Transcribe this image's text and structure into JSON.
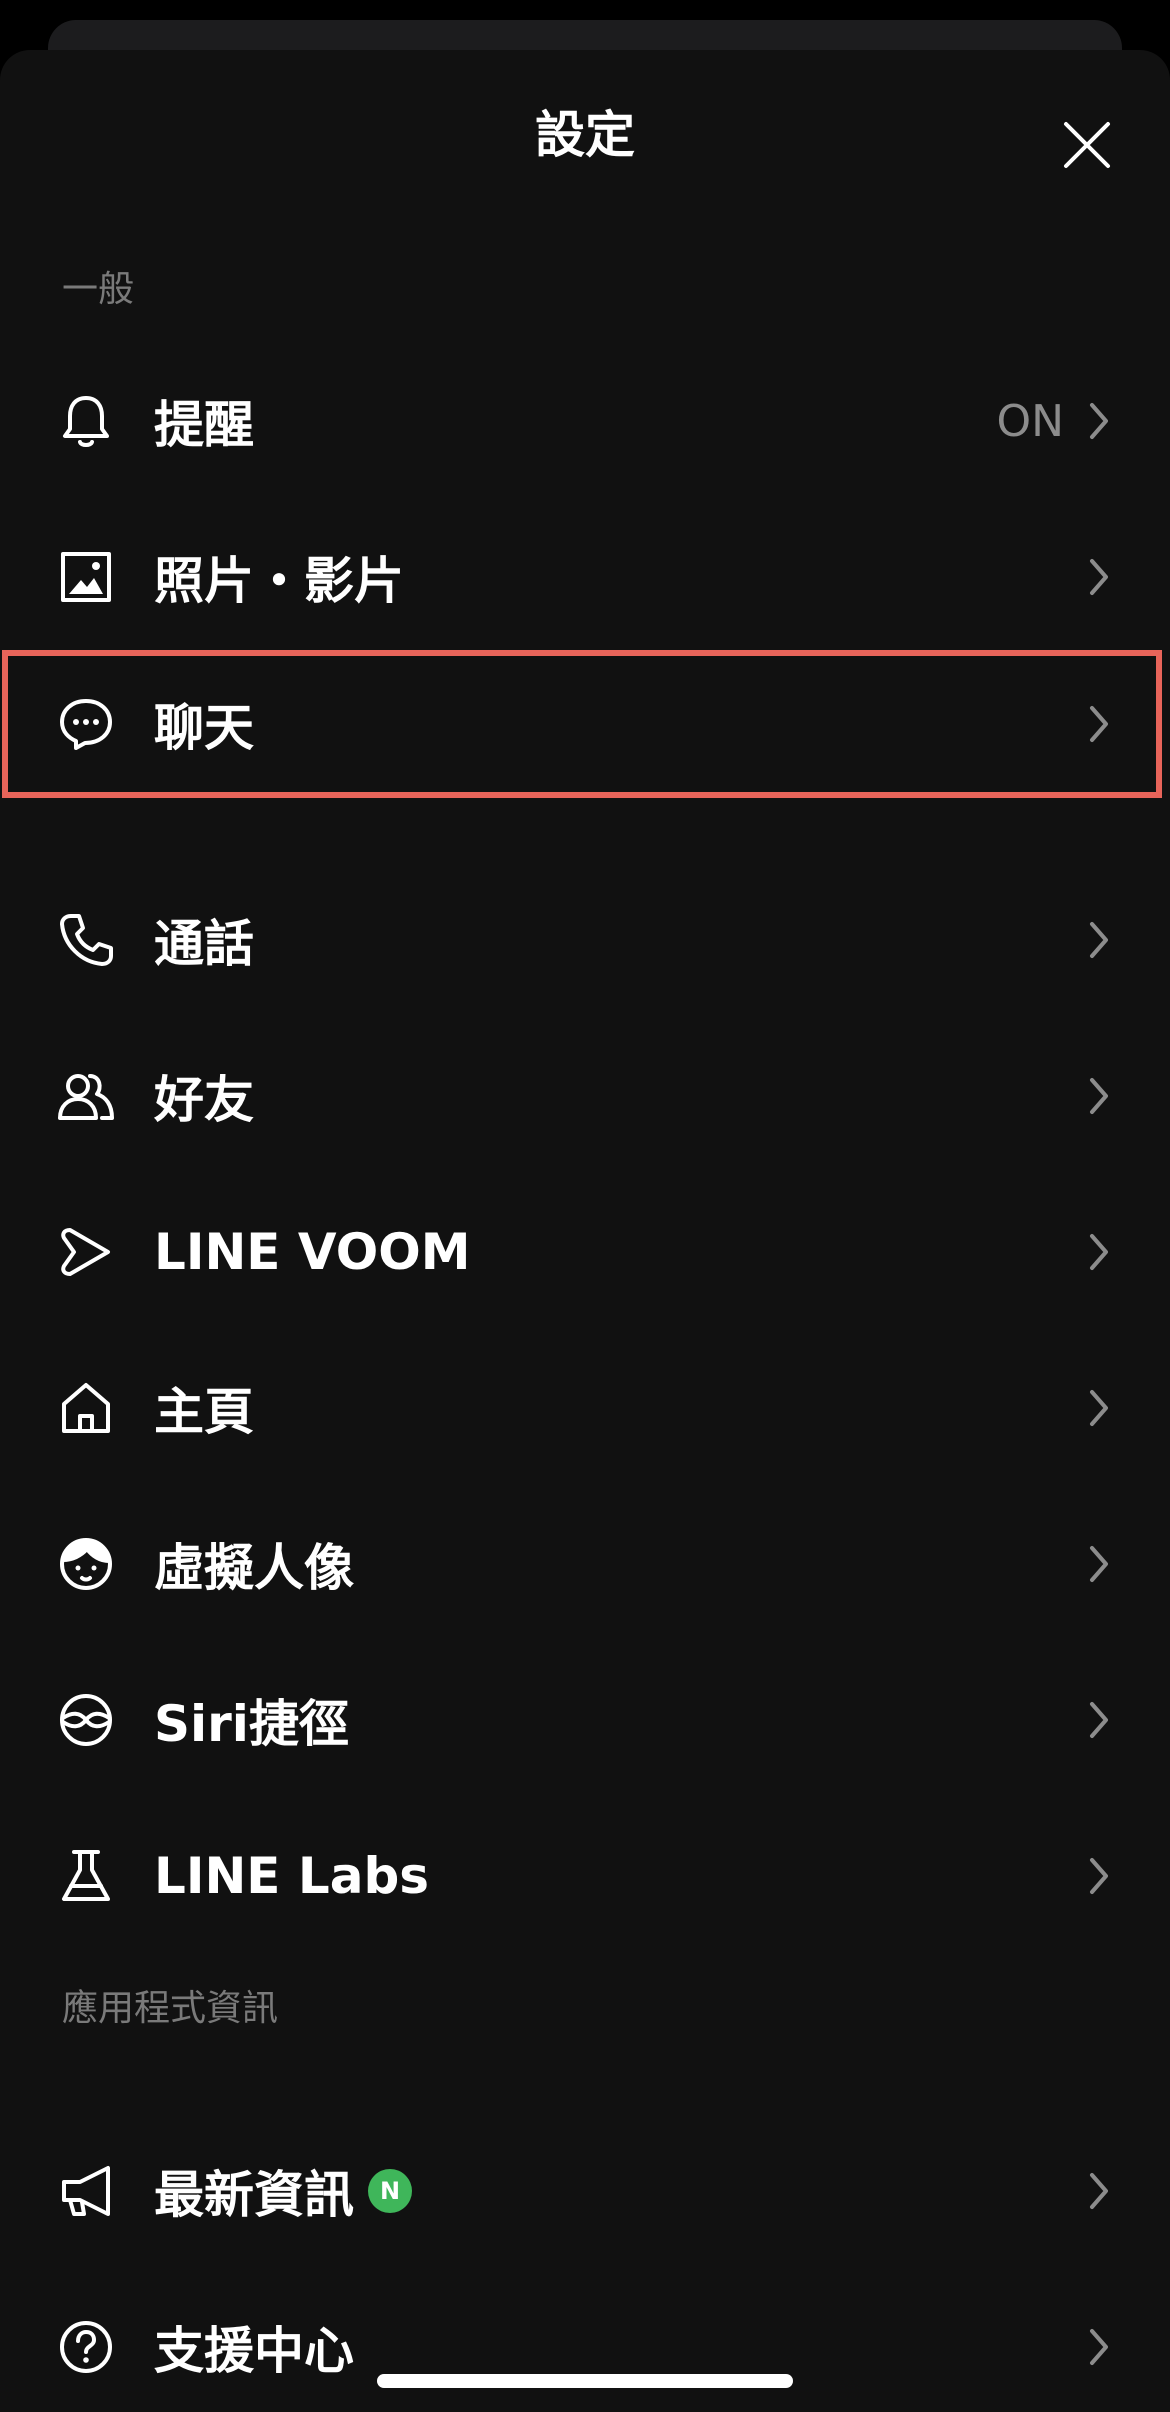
{
  "header": {
    "title": "設定"
  },
  "sections": {
    "general": "一般",
    "app_info": "應用程式資訊"
  },
  "rows": {
    "notifications": {
      "label": "提醒",
      "value": "ON",
      "icon": "bell-icon"
    },
    "photos_videos": {
      "label": "照片・影片",
      "icon": "photo-icon"
    },
    "chats": {
      "label": "聊天",
      "icon": "chat-bubble-icon"
    },
    "calls": {
      "label": "通話",
      "icon": "phone-icon"
    },
    "friends": {
      "label": "好友",
      "icon": "friends-icon"
    },
    "line_voom": {
      "label": "LINE VOOM",
      "icon": "voom-icon"
    },
    "home": {
      "label": "主頁",
      "icon": "home-icon"
    },
    "avatar": {
      "label": "虛擬人像",
      "icon": "avatar-face-icon"
    },
    "siri": {
      "label": "Siri捷徑",
      "icon": "siri-icon"
    },
    "labs": {
      "label": "LINE Labs",
      "icon": "flask-icon"
    },
    "news": {
      "label": "最新資訊",
      "badge": "N",
      "icon": "megaphone-icon"
    },
    "help": {
      "label": "支援中心",
      "icon": "help-icon"
    }
  },
  "colors": {
    "background": "#111111",
    "highlight": "#e8645a",
    "badge": "#3fb65a"
  }
}
